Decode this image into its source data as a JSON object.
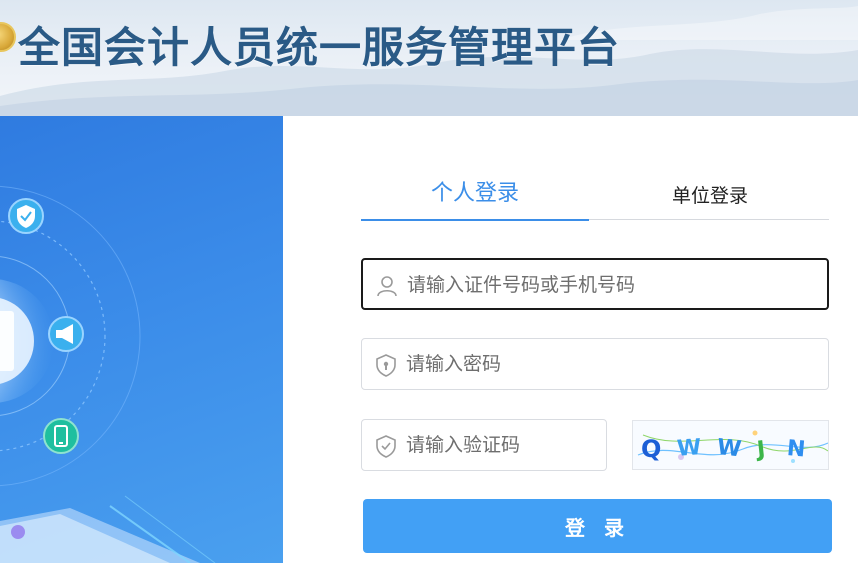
{
  "header": {
    "title": "全国会计人员统一服务管理平台"
  },
  "login": {
    "tabs": [
      {
        "label": "个人登录",
        "active": true
      },
      {
        "label": "单位登录",
        "active": false
      }
    ],
    "account": {
      "placeholder": "请输入证件号码或手机号码",
      "value": ""
    },
    "password": {
      "placeholder": "请输入密码",
      "value": ""
    },
    "captcha": {
      "placeholder": "请输入验证码",
      "value": "",
      "image_text": "QWWJN"
    },
    "submit_label": "登 录"
  },
  "colors": {
    "accent": "#3b8ee8",
    "button": "#42a0f5",
    "title": "#2a5a86",
    "banner": "#3b8ce9"
  },
  "icons": {
    "account": "user-icon",
    "password": "shield-lock-icon",
    "captcha": "shield-check-icon"
  }
}
